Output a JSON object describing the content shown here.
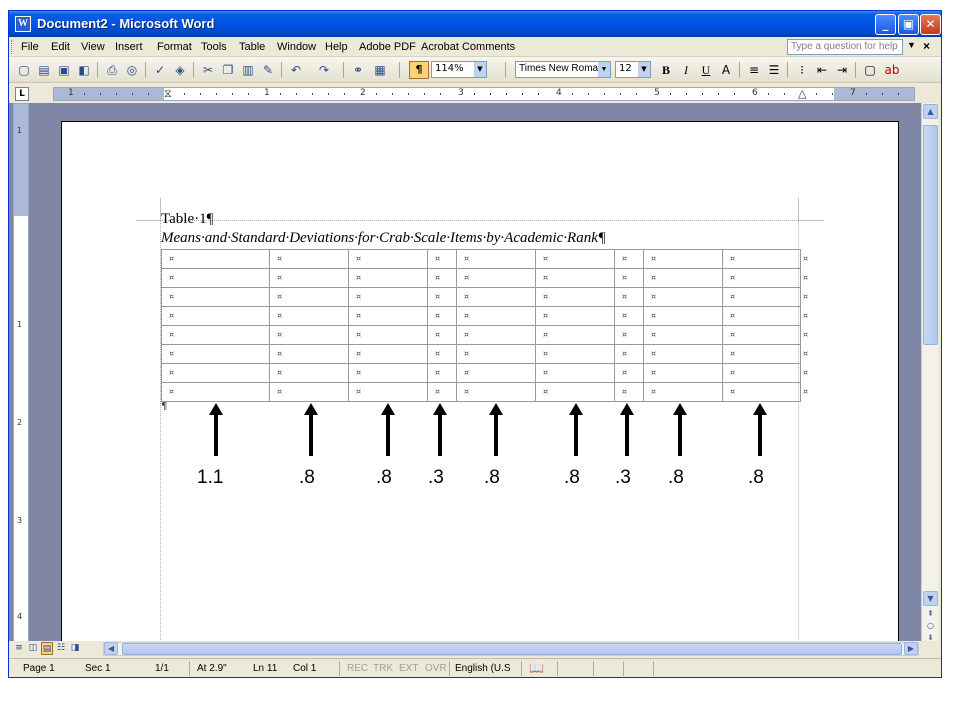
{
  "window": {
    "title": "Document2 - Microsoft Word"
  },
  "menubar": {
    "items": [
      "File",
      "Edit",
      "View",
      "Insert",
      "Format",
      "Tools",
      "Table",
      "Window",
      "Help",
      "Adobe PDF",
      "Acrobat Comments"
    ],
    "help_placeholder": "Type a question for help"
  },
  "toolbar": {
    "zoom": "114%",
    "font": "Times New Roman",
    "size": "12",
    "icons": [
      "new-icon",
      "open-icon",
      "save-icon",
      "permission-icon",
      "print-icon",
      "print-preview-icon",
      "spelling-icon",
      "research-icon",
      "cut-icon",
      "copy-icon",
      "paste-icon",
      "format-painter-icon",
      "undo-icon",
      "redo-icon",
      "hyperlink-icon",
      "tables-icon",
      "show-formatting-icon",
      "bold-icon",
      "italic-icon",
      "underline-icon",
      "align-icon",
      "justify-icon",
      "numbering-icon",
      "indent-icon",
      "border-icon",
      "highlight-icon"
    ]
  },
  "ruler": {
    "numbers": [
      "1",
      "1",
      "2",
      "3",
      "4",
      "5",
      "6",
      "7"
    ],
    "vnumbers": [
      "1",
      "1",
      "2",
      "3",
      "4"
    ]
  },
  "document": {
    "table_title": "Table·1¶",
    "table_subtitle": "Means·and·Standard·Deviations·for·Crab·Scale·Items·by·Academic·Rank¶",
    "cell_mark": "¤",
    "para_mark": "¶",
    "rows": 8,
    "columns": 9
  },
  "annotations": {
    "labels": [
      "1.1",
      ".8",
      ".8",
      ".3",
      ".8",
      ".8",
      ".3",
      ".8",
      ".8"
    ]
  },
  "statusbar": {
    "page": "Page  1",
    "sec": "Sec  1",
    "pages": "1/1",
    "at": "At  2.9\"",
    "ln": "Ln  11",
    "col": "Col  1",
    "rec": "REC",
    "trk": "TRK",
    "ext": "EXT",
    "ovr": "OVR",
    "language": "English (U.S"
  }
}
